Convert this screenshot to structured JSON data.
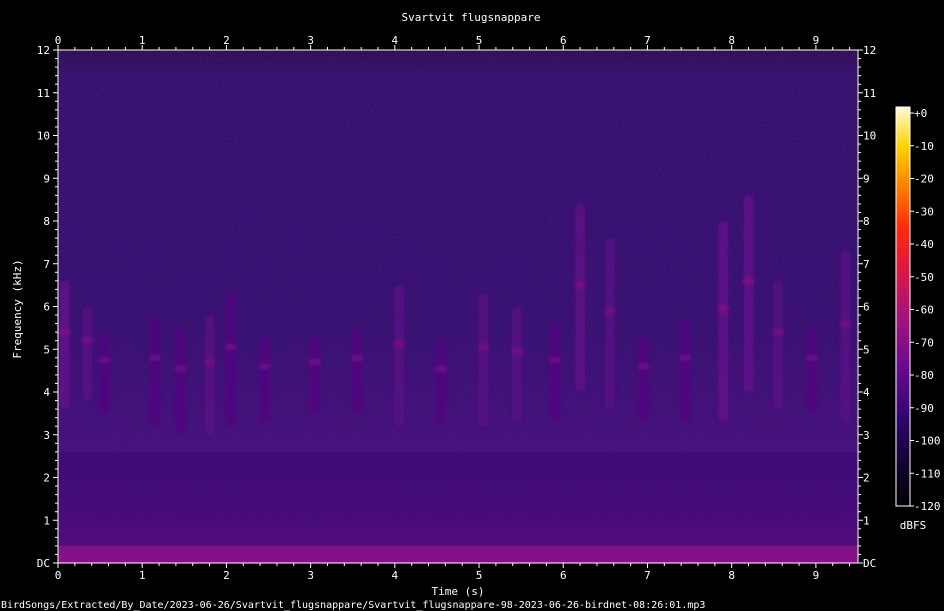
{
  "chart_data": {
    "type": "heatmap",
    "title": "Svartvit flugsnappare",
    "xlabel": "Time (s)",
    "ylabel": "Frequency (kHz)",
    "xlim": [
      0,
      9.5
    ],
    "ylim": [
      0,
      12
    ],
    "x_ticks": [
      "0",
      "1",
      "2",
      "3",
      "4",
      "5",
      "6",
      "7",
      "8",
      "9"
    ],
    "y_ticks": [
      "DC",
      "1",
      "2",
      "3",
      "4",
      "5",
      "6",
      "7",
      "8",
      "9",
      "10",
      "11",
      "12"
    ],
    "colorbar": {
      "label": "dBFS",
      "ticks": [
        "+0",
        "-10",
        "-20",
        "-30",
        "-40",
        "-50",
        "-60",
        "-70",
        "-80",
        "-90",
        "-100",
        "-110",
        "-120"
      ],
      "range": [
        -120,
        0
      ]
    },
    "caption": "BirdSongs/Extracted/By_Date/2023-06-26/Svartvit_flugsnappare/Svartvit_flugsnappare-98-2023-06-26-birdnet-08:26:01.mp3",
    "energy_bands_khz": [
      {
        "t_start": 0.0,
        "t_end": 9.5,
        "f_low": 0.0,
        "f_high": 0.4,
        "level_dbfs": -72
      },
      {
        "t_start": 0.0,
        "t_end": 9.5,
        "f_low": 0.4,
        "f_high": 2.6,
        "level_dbfs": -93
      }
    ],
    "calls": [
      {
        "t": 0.08,
        "f_low": 3.6,
        "f_high": 6.6,
        "level_dbfs": -78
      },
      {
        "t": 0.35,
        "f_low": 3.8,
        "f_high": 6.0,
        "level_dbfs": -82
      },
      {
        "t": 0.55,
        "f_low": 3.5,
        "f_high": 5.4,
        "level_dbfs": -85
      },
      {
        "t": 1.15,
        "f_low": 3.2,
        "f_high": 5.8,
        "level_dbfs": -85
      },
      {
        "t": 1.45,
        "f_low": 3.0,
        "f_high": 5.5,
        "level_dbfs": -84
      },
      {
        "t": 1.8,
        "f_low": 3.0,
        "f_high": 5.8,
        "level_dbfs": -82
      },
      {
        "t": 2.05,
        "f_low": 3.2,
        "f_high": 6.3,
        "level_dbfs": -84
      },
      {
        "t": 2.45,
        "f_low": 3.3,
        "f_high": 5.3,
        "level_dbfs": -84
      },
      {
        "t": 3.05,
        "f_low": 3.5,
        "f_high": 5.3,
        "level_dbfs": -84
      },
      {
        "t": 3.55,
        "f_low": 3.5,
        "f_high": 5.5,
        "level_dbfs": -84
      },
      {
        "t": 4.05,
        "f_low": 3.2,
        "f_high": 6.5,
        "level_dbfs": -82
      },
      {
        "t": 4.55,
        "f_low": 3.3,
        "f_high": 5.2,
        "level_dbfs": -84
      },
      {
        "t": 5.05,
        "f_low": 3.2,
        "f_high": 6.3,
        "level_dbfs": -82
      },
      {
        "t": 5.45,
        "f_low": 3.3,
        "f_high": 6.0,
        "level_dbfs": -82
      },
      {
        "t": 5.9,
        "f_low": 3.3,
        "f_high": 5.6,
        "level_dbfs": -84
      },
      {
        "t": 6.2,
        "f_low": 4.0,
        "f_high": 8.4,
        "level_dbfs": -80
      },
      {
        "t": 6.55,
        "f_low": 3.6,
        "f_high": 7.6,
        "level_dbfs": -82
      },
      {
        "t": 6.95,
        "f_low": 3.3,
        "f_high": 5.3,
        "level_dbfs": -84
      },
      {
        "t": 7.45,
        "f_low": 3.3,
        "f_high": 5.7,
        "level_dbfs": -84
      },
      {
        "t": 7.9,
        "f_low": 3.3,
        "f_high": 8.0,
        "level_dbfs": -78
      },
      {
        "t": 8.2,
        "f_low": 4.0,
        "f_high": 8.6,
        "level_dbfs": -78
      },
      {
        "t": 8.55,
        "f_low": 3.6,
        "f_high": 6.6,
        "level_dbfs": -82
      },
      {
        "t": 8.95,
        "f_low": 3.5,
        "f_high": 5.5,
        "level_dbfs": -84
      },
      {
        "t": 9.35,
        "f_low": 3.3,
        "f_high": 7.3,
        "level_dbfs": -82
      }
    ]
  }
}
